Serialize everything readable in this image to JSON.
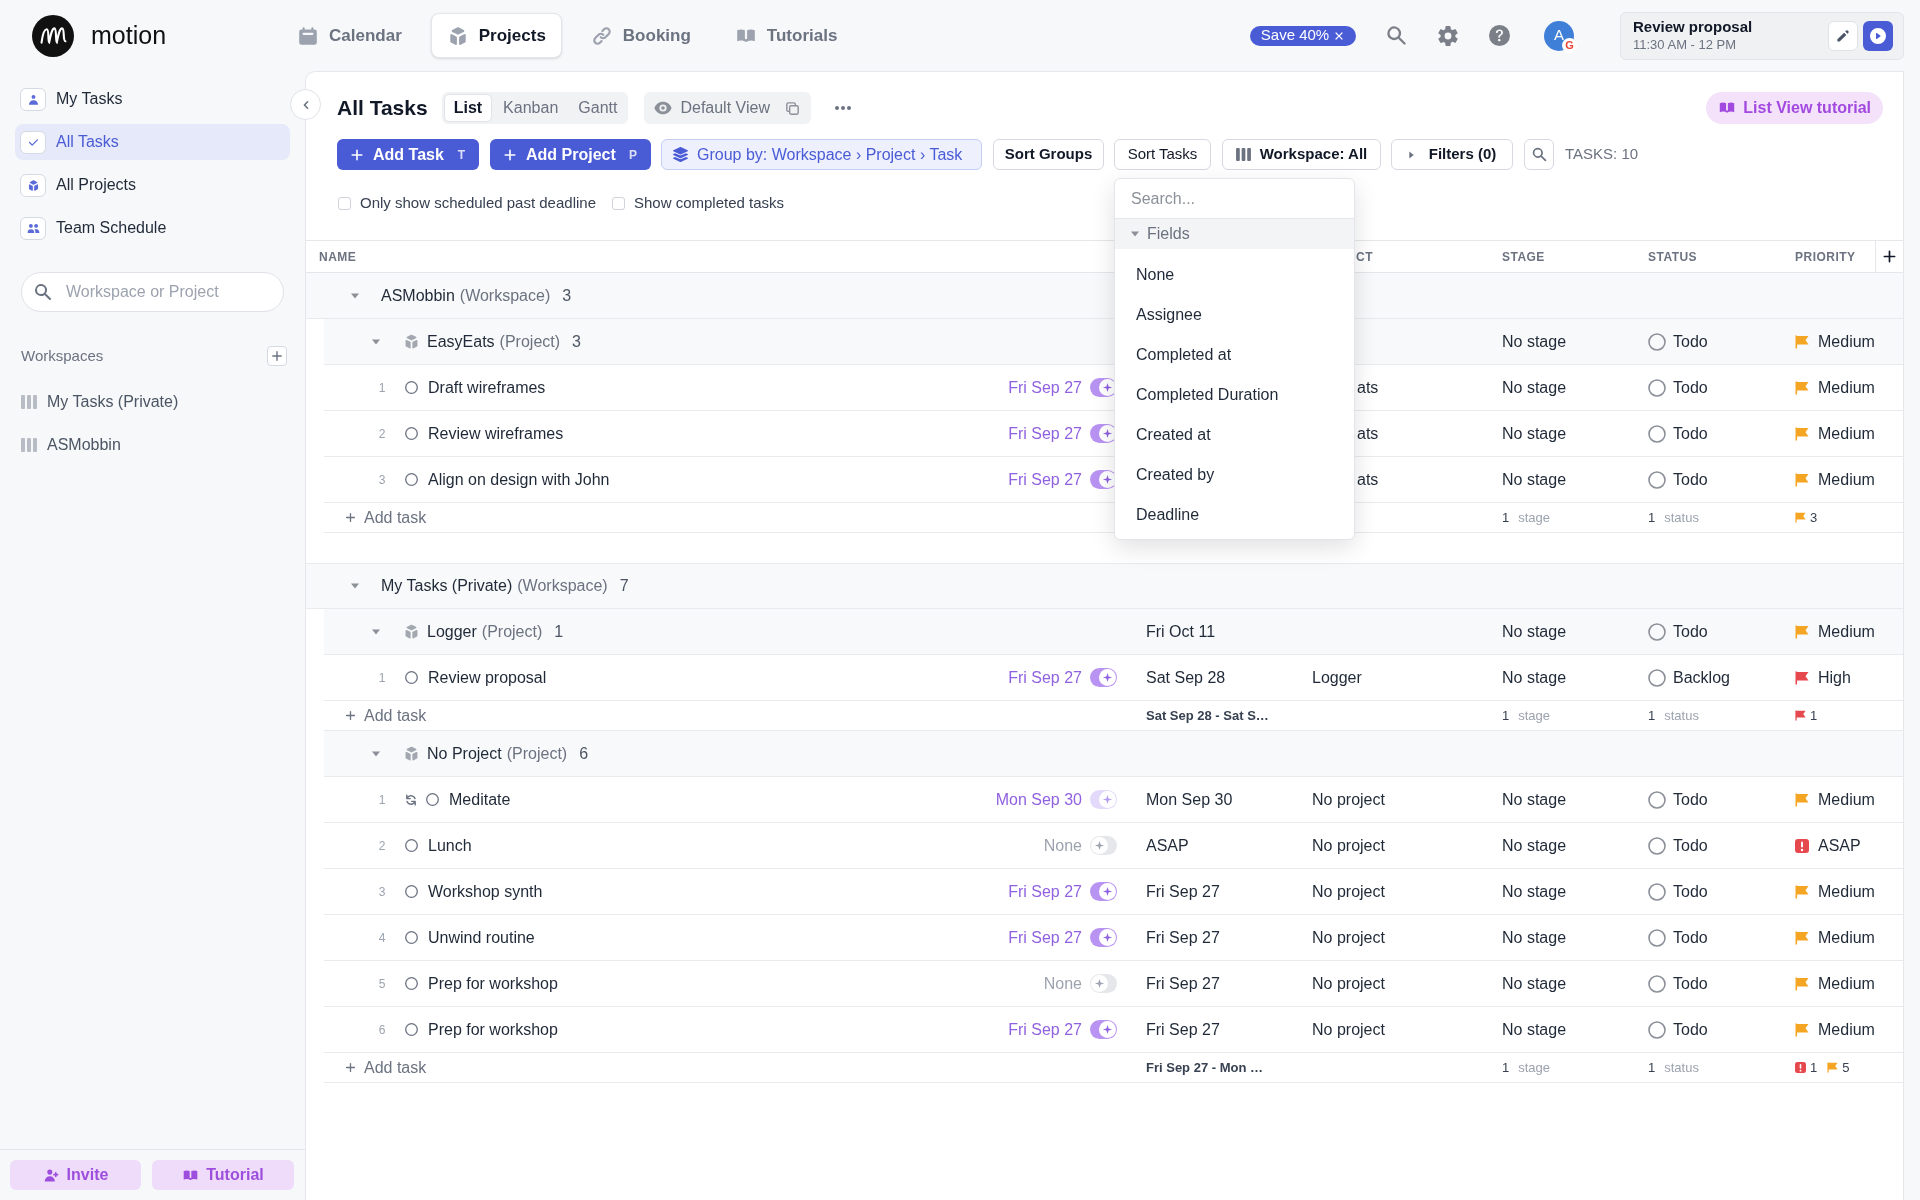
{
  "app": {
    "name": "motion"
  },
  "nav": [
    {
      "label": "Calendar",
      "selected": false
    },
    {
      "label": "Projects",
      "selected": true
    },
    {
      "label": "Booking",
      "selected": false
    },
    {
      "label": "Tutorials",
      "selected": false
    }
  ],
  "promo": {
    "label": "Save 40%"
  },
  "avatar": {
    "initial": "A",
    "badge": "G"
  },
  "current_task": {
    "title": "Review proposal",
    "time": "11:30 AM - 12 PM"
  },
  "sidebar": {
    "items": [
      {
        "label": "My Tasks",
        "selected": false
      },
      {
        "label": "All Tasks",
        "selected": true
      },
      {
        "label": "All Projects",
        "selected": false
      },
      {
        "label": "Team Schedule",
        "selected": false
      }
    ],
    "search": {
      "placeholder": "Workspace or Project"
    },
    "workspaces": {
      "title": "Workspaces",
      "items": [
        {
          "label": "My Tasks (Private)",
          "selected": false
        },
        {
          "label": "ASMobbin",
          "selected": false
        }
      ]
    },
    "footer": [
      {
        "label": "Invite"
      },
      {
        "label": "Tutorial"
      }
    ]
  },
  "view": {
    "title": "All Tasks",
    "modes": [
      {
        "label": "List",
        "selected": true
      },
      {
        "label": "Kanban",
        "selected": false
      },
      {
        "label": "Gantt",
        "selected": false
      }
    ],
    "saved_view": "Default View",
    "tutorial": "List View tutorial"
  },
  "toolbar": {
    "add_task": {
      "label": "Add Task",
      "shortcut": "T"
    },
    "add_project": {
      "label": "Add Project",
      "shortcut": "P"
    },
    "group_by": "Group by: Workspace › Project › Task",
    "sort_groups": {
      "label": "Sort Groups",
      "open": false
    },
    "sort_tasks": {
      "label": "Sort Tasks",
      "open": true
    },
    "workspace_filter": "Workspace: All",
    "filters": "Filters (0)",
    "task_count": "TASKS: 10"
  },
  "options": [
    {
      "label": "Only show scheduled past deadline",
      "checked": false
    },
    {
      "label": "Show completed tasks",
      "checked": false
    }
  ],
  "sort_menu": {
    "placeholder": "Search...",
    "section": "Fields",
    "expanded": true,
    "items": [
      {
        "label": "None",
        "selected": false
      },
      {
        "label": "Assignee",
        "selected": false
      },
      {
        "label": "Completed at",
        "selected": false
      },
      {
        "label": "Completed Duration",
        "selected": false
      },
      {
        "label": "Created at",
        "selected": false
      },
      {
        "label": "Created by",
        "selected": false
      },
      {
        "label": "Deadline",
        "selected": false
      }
    ]
  },
  "table": {
    "columns": {
      "name": "NAME",
      "column_3": "CT",
      "stage": "STAGE",
      "status": "STATUS",
      "priority": "PRIORITY"
    },
    "groups": [
      {
        "name": "ASMobbin",
        "type": "(Workspace)",
        "count": "3",
        "expanded": true,
        "projects": [
          {
            "name": "EasyEats",
            "type": "(Project)",
            "count": "3",
            "expanded": true,
            "stage": "No stage",
            "status": "Todo",
            "priority": {
              "label": "Medium",
              "kind": "flag",
              "color": "#f5a524"
            },
            "tasks": [
              {
                "number": "1",
                "name": "Draft wireframes",
                "completed": false,
                "recurring": false,
                "deadline": "Fri Sep 27",
                "auto_schedule": {
                  "on": true,
                  "disabled": false
                },
                "column_3": "ats",
                "stage": "No stage",
                "status": "Todo",
                "priority": {
                  "label": "Medium",
                  "kind": "flag",
                  "color": "#f5a524"
                }
              },
              {
                "number": "2",
                "name": "Review wireframes",
                "completed": false,
                "recurring": false,
                "deadline": "Fri Sep 27",
                "auto_schedule": {
                  "on": true,
                  "disabled": false
                },
                "column_3": "ats",
                "stage": "No stage",
                "status": "Todo",
                "priority": {
                  "label": "Medium",
                  "kind": "flag",
                  "color": "#f5a524"
                }
              },
              {
                "number": "3",
                "name": "Align on design with John",
                "completed": false,
                "recurring": false,
                "deadline": "Fri Sep 27",
                "auto_schedule": {
                  "on": true,
                  "disabled": false
                },
                "column_3": "ats",
                "stage": "No stage",
                "status": "Todo",
                "priority": {
                  "label": "Medium",
                  "kind": "flag",
                  "color": "#f5a524"
                }
              }
            ],
            "summary": {
              "add_label": "Add task",
              "stage_count": "1",
              "stage_label": "stage",
              "status_count": "1",
              "status_label": "status",
              "priorities": [
                {
                  "kind": "flag",
                  "color": "#f5a524",
                  "count": "3"
                }
              ]
            }
          }
        ]
      },
      {
        "name": "My Tasks (Private)",
        "type": "(Workspace)",
        "count": "7",
        "expanded": true,
        "projects": [
          {
            "name": "Logger",
            "type": "(Project)",
            "count": "1",
            "expanded": true,
            "column_2": "Fri Oct 11",
            "stage": "No stage",
            "status": "Todo",
            "priority": {
              "label": "Medium",
              "kind": "flag",
              "color": "#f5a524"
            },
            "tasks": [
              {
                "number": "1",
                "name": "Review proposal",
                "completed": false,
                "recurring": false,
                "deadline": "Fri Sep 27",
                "auto_schedule": {
                  "on": true,
                  "disabled": false
                },
                "column_2": "Sat Sep 28",
                "column_3": "Logger",
                "stage": "No stage",
                "status": "Backlog",
                "priority": {
                  "label": "High",
                  "kind": "flag",
                  "color": "#e5484d"
                }
              }
            ],
            "summary": {
              "add_label": "Add task",
              "column_2": "Sat Sep 28 - Sat S…",
              "stage_count": "1",
              "stage_label": "stage",
              "status_count": "1",
              "status_label": "status",
              "priorities": [
                {
                  "kind": "flag",
                  "color": "#e5484d",
                  "count": "1"
                }
              ]
            }
          },
          {
            "name": "No Project",
            "type": "(Project)",
            "count": "6",
            "expanded": true,
            "tasks": [
              {
                "number": "1",
                "name": "Meditate",
                "completed": false,
                "recurring": true,
                "deadline": "Mon Sep 30",
                "auto_schedule": {
                  "on": true,
                  "disabled": true
                },
                "column_2": "Mon Sep 30",
                "column_3": "No project",
                "stage": "No stage",
                "status": "Todo",
                "priority": {
                  "label": "Medium",
                  "kind": "flag",
                  "color": "#f5a524"
                }
              },
              {
                "number": "2",
                "name": "Lunch",
                "completed": false,
                "recurring": false,
                "deadline": "None",
                "auto_schedule": {
                  "on": false,
                  "disabled": false
                },
                "column_2": "ASAP",
                "column_3": "No project",
                "stage": "No stage",
                "status": "Todo",
                "priority": {
                  "label": "ASAP",
                  "kind": "alert",
                  "color": "#e5484d"
                }
              },
              {
                "number": "3",
                "name": "Workshop synth",
                "completed": false,
                "recurring": false,
                "deadline": "Fri Sep 27",
                "auto_schedule": {
                  "on": true,
                  "disabled": false
                },
                "column_2": "Fri Sep 27",
                "column_3": "No project",
                "stage": "No stage",
                "status": "Todo",
                "priority": {
                  "label": "Medium",
                  "kind": "flag",
                  "color": "#f5a524"
                }
              },
              {
                "number": "4",
                "name": "Unwind routine",
                "completed": false,
                "recurring": false,
                "deadline": "Fri Sep 27",
                "auto_schedule": {
                  "on": true,
                  "disabled": false
                },
                "column_2": "Fri Sep 27",
                "column_3": "No project",
                "stage": "No stage",
                "status": "Todo",
                "priority": {
                  "label": "Medium",
                  "kind": "flag",
                  "color": "#f5a524"
                }
              },
              {
                "number": "5",
                "name": "Prep for workshop",
                "completed": false,
                "recurring": false,
                "deadline": "None",
                "auto_schedule": {
                  "on": false,
                  "disabled": false
                },
                "column_2": "Fri Sep 27",
                "column_3": "No project",
                "stage": "No stage",
                "status": "Todo",
                "priority": {
                  "label": "Medium",
                  "kind": "flag",
                  "color": "#f5a524"
                }
              },
              {
                "number": "6",
                "name": "Prep for workshop",
                "completed": false,
                "recurring": false,
                "deadline": "Fri Sep 27",
                "auto_schedule": {
                  "on": true,
                  "disabled": false
                },
                "column_2": "Fri Sep 27",
                "column_3": "No project",
                "stage": "No stage",
                "status": "Todo",
                "priority": {
                  "label": "Medium",
                  "kind": "flag",
                  "color": "#f5a524"
                }
              }
            ],
            "summary": {
              "add_label": "Add task",
              "column_2": "Fri Sep 27 - Mon …",
              "stage_count": "1",
              "stage_label": "stage",
              "status_count": "1",
              "status_label": "status",
              "priorities": [
                {
                  "kind": "alert",
                  "color": "#e5484d",
                  "count": "1"
                },
                {
                  "kind": "flag",
                  "color": "#f5a524",
                  "count": "5"
                }
              ]
            }
          }
        ]
      }
    ]
  }
}
